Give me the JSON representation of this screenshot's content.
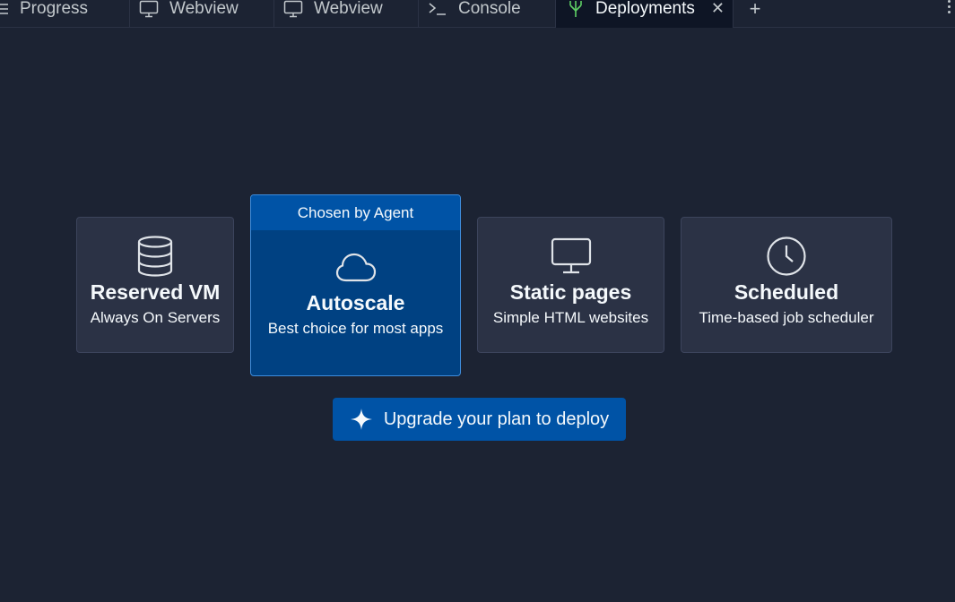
{
  "tabs": [
    {
      "label": "Progress",
      "icon": "progress-icon"
    },
    {
      "label": "Webview",
      "icon": "monitor-icon"
    },
    {
      "label": "Webview",
      "icon": "monitor-icon"
    },
    {
      "label": "Console",
      "icon": "terminal-icon"
    },
    {
      "label": "Deployments",
      "icon": "deployments-icon",
      "active": true,
      "close": "✕"
    }
  ],
  "tabbar": {
    "add_label": "+"
  },
  "deployment_types": [
    {
      "title": "Reserved VM",
      "description": "Always On Servers",
      "icon": "database-icon"
    },
    {
      "badge": "Chosen by Agent",
      "title": "Autoscale",
      "description": "Best choice for most apps",
      "icon": "cloud-icon"
    },
    {
      "title": "Static pages",
      "description": "Simple HTML websites",
      "icon": "monitor-icon"
    },
    {
      "title": "Scheduled",
      "description": "Time-based job scheduler",
      "icon": "clock-icon"
    }
  ],
  "upgrade": {
    "label": "Upgrade your plan to deploy",
    "icon": "sparkle-icon"
  },
  "colors": {
    "background": "#1c2333",
    "card": "#2b3245",
    "chosen_card": "#004182",
    "accent_blue": "#0053a6",
    "deploy_icon_green": "#5fcf65"
  }
}
